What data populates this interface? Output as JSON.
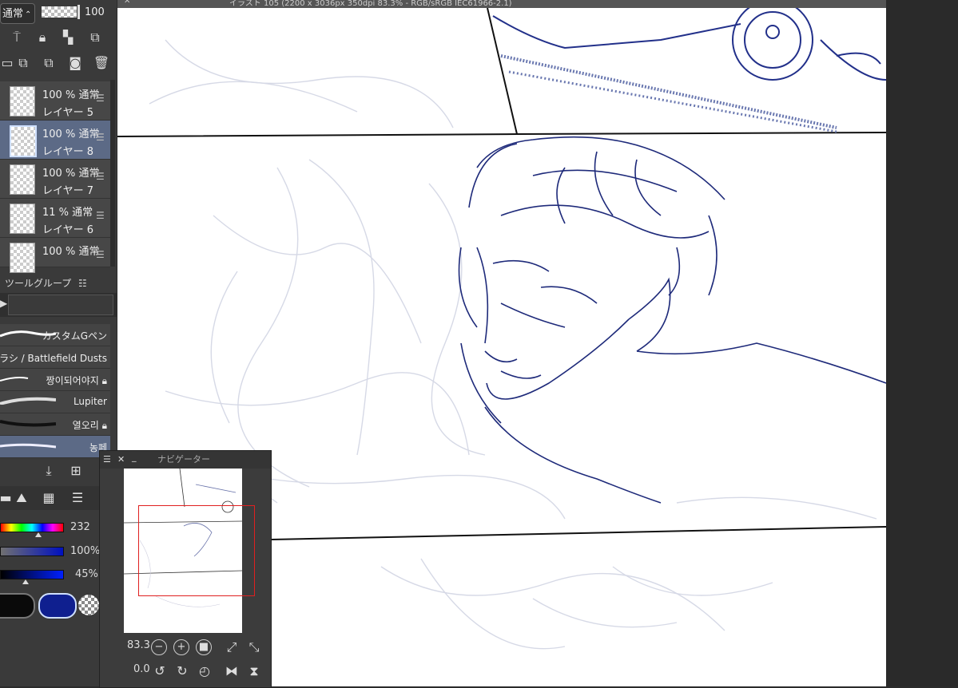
{
  "document_tab": "イラスト 105 (2200 x 3036px 350dpi 83.3% - RGB/sRGB IEC61966-2.1)",
  "layer_panel": {
    "blend_mode": "通常",
    "opacity_value": "100",
    "layers": [
      {
        "opacity": "100 %",
        "mode": "通常",
        "name": "レイヤー 5",
        "selected": false
      },
      {
        "opacity": "100 %",
        "mode": "通常",
        "name": "レイヤー 8",
        "selected": true
      },
      {
        "opacity": "100 %",
        "mode": "通常",
        "name": "レイヤー 7",
        "selected": false
      },
      {
        "opacity": "11 %",
        "mode": "通常",
        "name": "レイヤー 6",
        "selected": false
      },
      {
        "opacity": "100 %",
        "mode": "通常",
        "name": "",
        "selected": false
      }
    ]
  },
  "tool_group": {
    "label": "ツールグループ",
    "brushes": [
      {
        "name": "カスタムGペン",
        "locked": false
      },
      {
        "name": "ブラシ / Battlefield Dusts",
        "locked": false
      },
      {
        "name": "짱이되어야지",
        "locked": true
      },
      {
        "name": "Lupiter",
        "locked": false
      },
      {
        "name": "열오리",
        "locked": true
      },
      {
        "name": "농페",
        "locked": false
      }
    ]
  },
  "color": {
    "hue_value": "232",
    "saturation_value": "100%",
    "brightness_value": "45%",
    "main_color": "#0a0a0a",
    "sub_color": "#0f1f8f",
    "hue_colors": [
      "#ff0000",
      "#ffff00",
      "#00ff00",
      "#00ffff",
      "#0000ff",
      "#ff00ff",
      "#ff0000"
    ]
  },
  "navigator": {
    "title": "ナビゲーター",
    "zoom": "83.3",
    "rotation": "0.0"
  },
  "icons": {
    "blend_dropdown": "chevron-updown-icon",
    "layer_menu": "hamburger-icon",
    "lock": "lock-icon",
    "trash": "trash-icon"
  }
}
